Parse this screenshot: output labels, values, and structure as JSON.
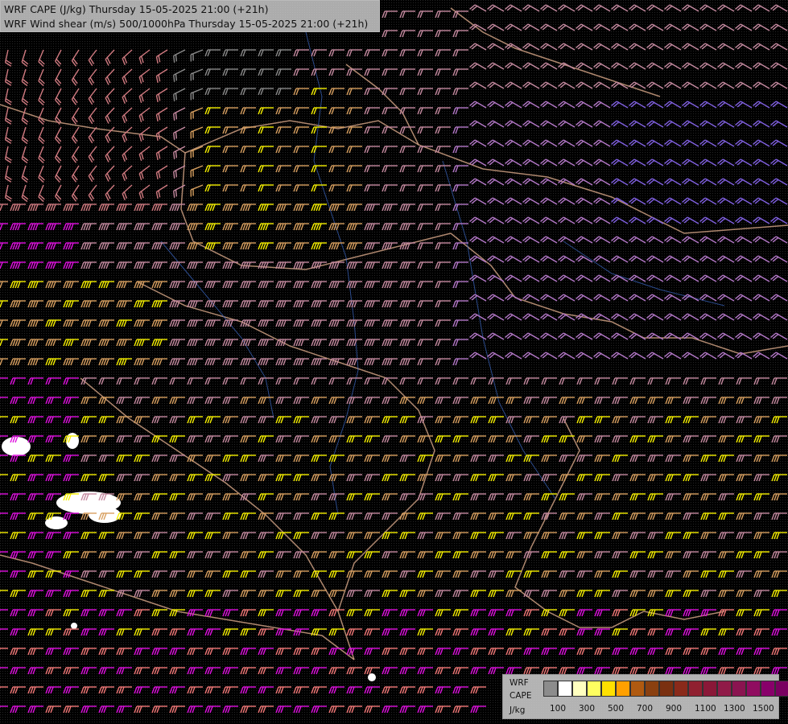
{
  "header": {
    "line1": "WRF CAPE (J/kg) Thursday 15-05-2025 21:00 (+21h)",
    "line2": "WRF Wind shear (m/s) 500/1000hPa Thursday 15-05-2025 21:00 (+21h)"
  },
  "legend": {
    "line1": "WRF",
    "line2": "CAPE",
    "unit": "J/kg",
    "tick_labels": [
      "100",
      "300",
      "500",
      "700",
      "900",
      "1100",
      "1300",
      "1500"
    ],
    "colors": [
      "#8c8c8c",
      "#ffffff",
      "#ffffc0",
      "#ffff60",
      "#ffe000",
      "#ffa000",
      "#b05a10",
      "#8a4010",
      "#7a3010",
      "#8a2a1a",
      "#902030",
      "#8a1838",
      "#901a48",
      "#8a1450",
      "#900c60",
      "#88006a",
      "#7a0060"
    ]
  },
  "palette": {
    "calm": "#8a8a8a",
    "light": "#d07a80",
    "moderate": "#f27878",
    "strong": "#c58aa0",
    "magenta": "#e010e0",
    "yellow": "#f6f000",
    "tan": "#d8a060",
    "purple": "#b478c8",
    "violet": "#8060e0",
    "border": "#d9a98a",
    "river": "#3c6ac8",
    "cape_low": "#ffffff"
  }
}
